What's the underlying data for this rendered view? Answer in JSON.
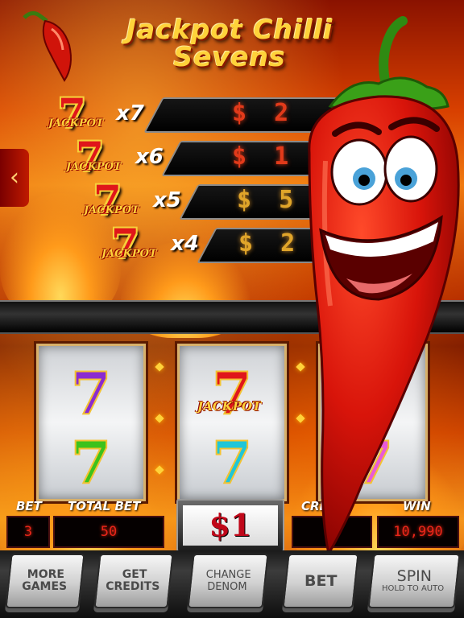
{
  "title": {
    "line1": "Jackpot Chilli",
    "line2": "Sevens"
  },
  "paytable": [
    {
      "label": "JACKPOT",
      "multiplier": "x7",
      "amount": "$ 2",
      "amount_color": "red"
    },
    {
      "label": "JACKPOT",
      "multiplier": "x6",
      "amount": "$ 1",
      "amount_color": "red"
    },
    {
      "label": "JACKPOT",
      "multiplier": "x5",
      "amount": "$ 5",
      "amount_color": "gold"
    },
    {
      "label": "JACKPOT",
      "multiplier": "x4",
      "amount": "$ 2",
      "amount_color": "gold"
    }
  ],
  "back_tab": {
    "icon": "chevron-left-icon",
    "glyph": "‹"
  },
  "reels": [
    {
      "symbols": [
        {
          "glyph": "7",
          "color": "#8a2bd0"
        },
        {
          "glyph": "7",
          "color": "#3cc21c"
        }
      ]
    },
    {
      "symbols": [
        {
          "glyph": "7",
          "color": "#e0161a",
          "label": "JACKPOT"
        },
        {
          "glyph": "7",
          "color": "#1fc6d8"
        }
      ]
    },
    {
      "symbols": [
        {
          "glyph": "7",
          "color": "#f0a81a"
        },
        {
          "glyph": "7",
          "color": "#e85ad8"
        }
      ]
    }
  ],
  "meters": {
    "bet_label": "BET",
    "bet_value": "3",
    "total_bet_label": "TOTAL BET",
    "total_bet_value": "50",
    "denom_value": "$1",
    "credits_label": "CRE",
    "credits_value": "",
    "win_label": "WIN",
    "win_value": "10,990"
  },
  "buttons": {
    "more_games": [
      "MORE",
      "GAMES"
    ],
    "get_credits": [
      "GET",
      "CREDITS"
    ],
    "change_denom": [
      "CHANGE",
      "DENOM"
    ],
    "bet": "BET",
    "spin": "SPIN",
    "spin_sub": "HOLD TO AUTO"
  },
  "colors": {
    "accent_gold": "#ffd23a",
    "led_red": "#e8261a",
    "chili_red": "#d81a0a"
  }
}
